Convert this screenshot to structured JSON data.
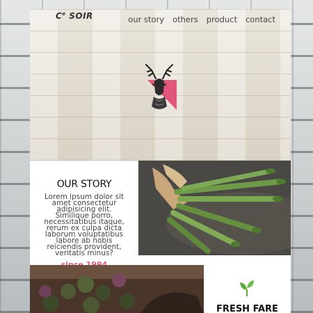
{
  "brand": {
    "logo_text": "C",
    "logo_sup": "e",
    "logo_rest": " SOIR"
  },
  "nav": {
    "items": [
      "our story",
      "others",
      "product",
      "contact"
    ]
  },
  "story": {
    "title": "OUR STORY",
    "body": "Lorem ipsum dolor sit amet consectetur adipisicing elit. Similique porro, necessitatibus itaque, rerum ex culpa dicta laborum voluptatibus labore ab nobis reiciendis provident, veritatis minus?",
    "since": "since 1994"
  },
  "feature": {
    "title": "FRESH FARE"
  },
  "colors": {
    "accent": "#e2557c",
    "leaf": "#5aa93c"
  },
  "icons": {
    "hero": "deer-icon",
    "feature": "leaf-icon"
  }
}
